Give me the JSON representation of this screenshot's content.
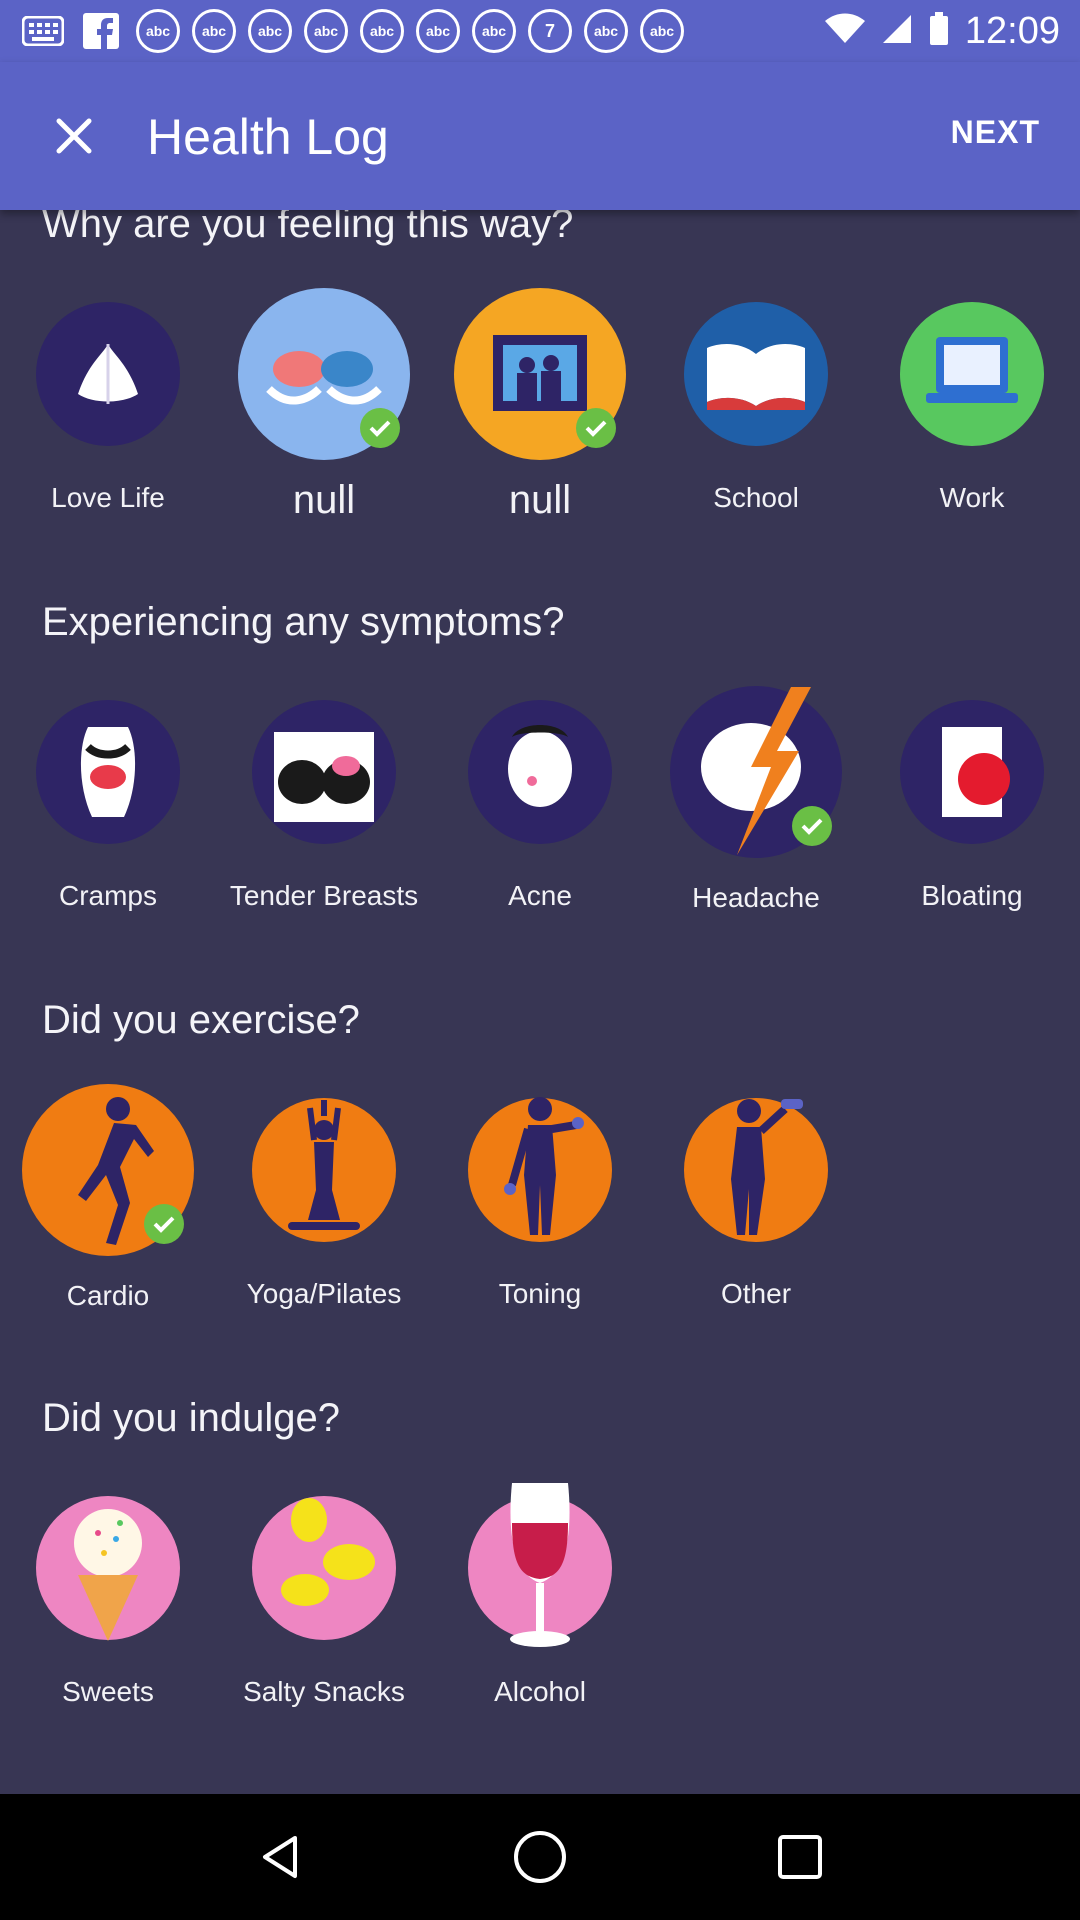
{
  "status_bar": {
    "time": "12:09",
    "notification_icons": [
      "grid-icon",
      "facebook-icon",
      "abc-icon",
      "abc-icon",
      "abc-icon",
      "abc-icon",
      "abc-icon",
      "abc-icon",
      "abc-icon",
      "abc7-icon",
      "abc-icon",
      "abc-icon"
    ],
    "abc_text": "abc"
  },
  "app_bar": {
    "title": "Health Log",
    "next_label": "NEXT"
  },
  "sections": [
    {
      "title": "Why are you feeling this way?",
      "items": [
        {
          "label": "Love Life",
          "selected": false,
          "color": "#2e2466"
        },
        {
          "label": "null",
          "selected": true,
          "color": "#8ab5ee"
        },
        {
          "label": "null",
          "selected": true,
          "color": "#f5a623"
        },
        {
          "label": "School",
          "selected": false,
          "color": "#1f5fa8"
        },
        {
          "label": "Work",
          "selected": false,
          "color": "#58c85f"
        }
      ]
    },
    {
      "title": "Experiencing any symptoms?",
      "items": [
        {
          "label": "Cramps",
          "selected": false,
          "color": "#2e2466"
        },
        {
          "label": "Tender Breasts",
          "selected": false,
          "color": "#2e2466"
        },
        {
          "label": "Acne",
          "selected": false,
          "color": "#2e2466"
        },
        {
          "label": "Headache",
          "selected": true,
          "color": "#2e2466"
        },
        {
          "label": "Bloating",
          "selected": false,
          "color": "#2e2466"
        }
      ]
    },
    {
      "title": "Did you exercise?",
      "items": [
        {
          "label": "Cardio",
          "selected": true,
          "color": "#f07c12"
        },
        {
          "label": "Yoga/Pilates",
          "selected": false,
          "color": "#f07c12"
        },
        {
          "label": "Toning",
          "selected": false,
          "color": "#f07c12"
        },
        {
          "label": "Other",
          "selected": false,
          "color": "#f07c12"
        }
      ]
    },
    {
      "title": "Did you indulge?",
      "items": [
        {
          "label": "Sweets",
          "selected": false,
          "color": "#ee86c2"
        },
        {
          "label": "Salty Snacks",
          "selected": false,
          "color": "#ee86c2"
        },
        {
          "label": "Alcohol",
          "selected": false,
          "color": "#ee86c2"
        }
      ]
    }
  ],
  "colors": {
    "primary": "#5b63c6",
    "background": "#383654",
    "check": "#6abf45"
  }
}
